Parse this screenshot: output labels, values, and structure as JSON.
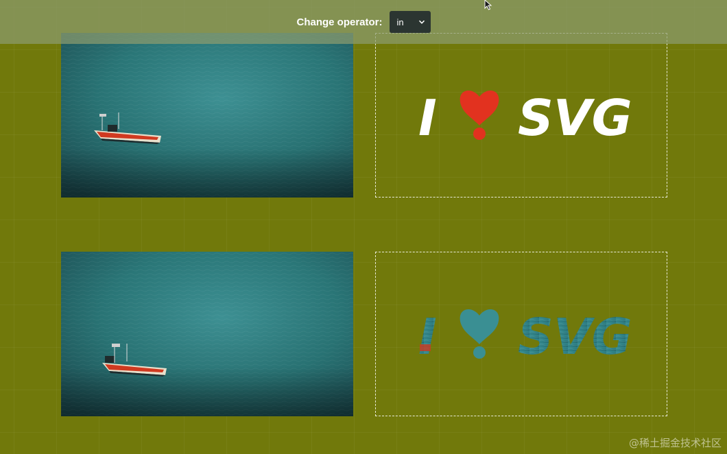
{
  "header": {
    "operator_label": "Change operator:",
    "operator_value": "in"
  },
  "icons": {
    "dropdown": "chevron-down-icon",
    "cursor": "mouse-pointer-icon"
  },
  "panels": {
    "text": "I ❤ SVG",
    "text_letter_i": "I",
    "text_letters_svg": "SVG",
    "heart_icon": "heart-exclamation-icon"
  },
  "colors": {
    "background": "#71790b",
    "topbar": "#8c9b6e",
    "water": "#2f8a8e",
    "heart": "#e2321f",
    "select_bg": "#2b3531"
  },
  "watermark": "@稀土掘金技术社区"
}
